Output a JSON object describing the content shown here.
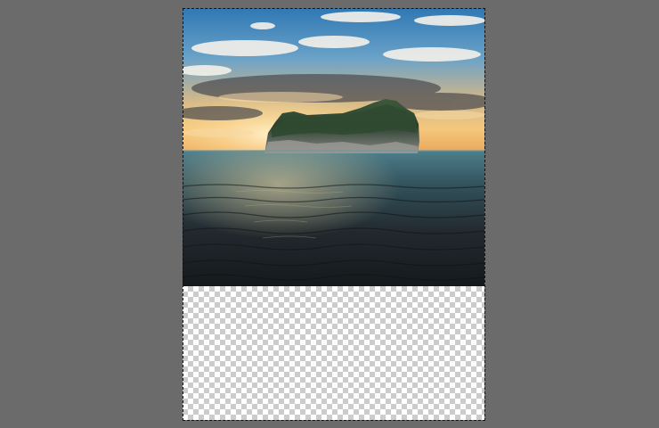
{
  "colors": {
    "workspace_bg": "#6b6b6b",
    "checker_light": "#ffffff",
    "checker_dark": "#cccccc",
    "sky_top": "#3a7fb8",
    "sky_horizon": "#f3c27a",
    "sea_dark": "#1c2226",
    "sea_light": "#4a7a88"
  },
  "icons": {
    "transparency_pattern": "checkerboard-pattern",
    "marquee": "marching-ants-selection"
  }
}
